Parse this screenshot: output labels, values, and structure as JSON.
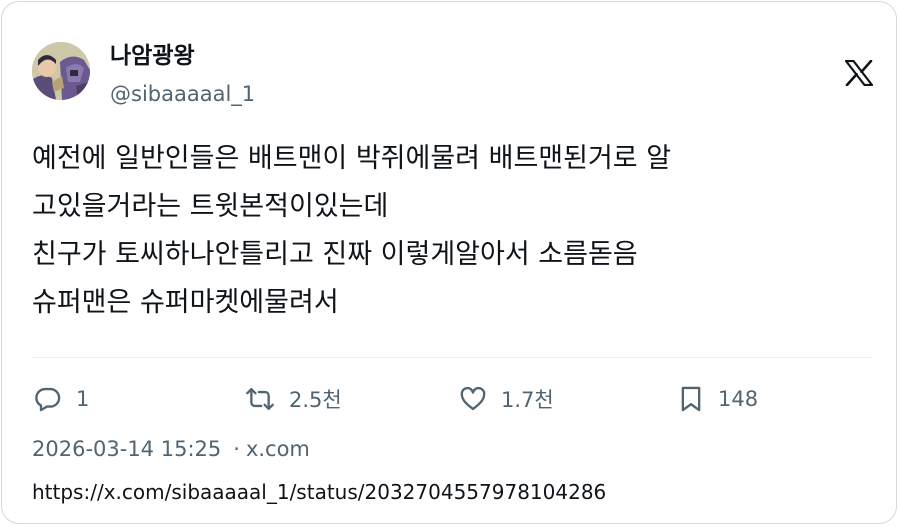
{
  "author": {
    "display_name": "나암광왕",
    "handle": "@sibaaaaal_1",
    "avatar": "avatar-illustration"
  },
  "brand_icon": "x-logo-icon",
  "tweet": {
    "text": "예전에 일반인들은 배트맨이 박쥐에물려 배트맨된거로 알\n고있을거라는 트윗본적이있는데\n친구가 토씨하나안틀리고 진짜 이렇게알아서 소름돋음\n슈퍼맨은 슈퍼마켓에물려서"
  },
  "actions": {
    "reply": {
      "icon": "reply-icon",
      "count": "1"
    },
    "repost": {
      "icon": "repost-icon",
      "count": "2.5천"
    },
    "like": {
      "icon": "heart-icon",
      "count": "1.7천"
    },
    "bookmark": {
      "icon": "bookmark-icon",
      "count": "148"
    }
  },
  "meta": {
    "timestamp": "2026-03-14 15:25",
    "separator": "·",
    "source": "x.com"
  },
  "url": "https://x.com/sibaaaaal_1/status/2032704557978104286",
  "colors": {
    "text": "#0f1419",
    "secondary": "#536471",
    "border": "#cfd9de",
    "divider": "#eff3f4"
  }
}
